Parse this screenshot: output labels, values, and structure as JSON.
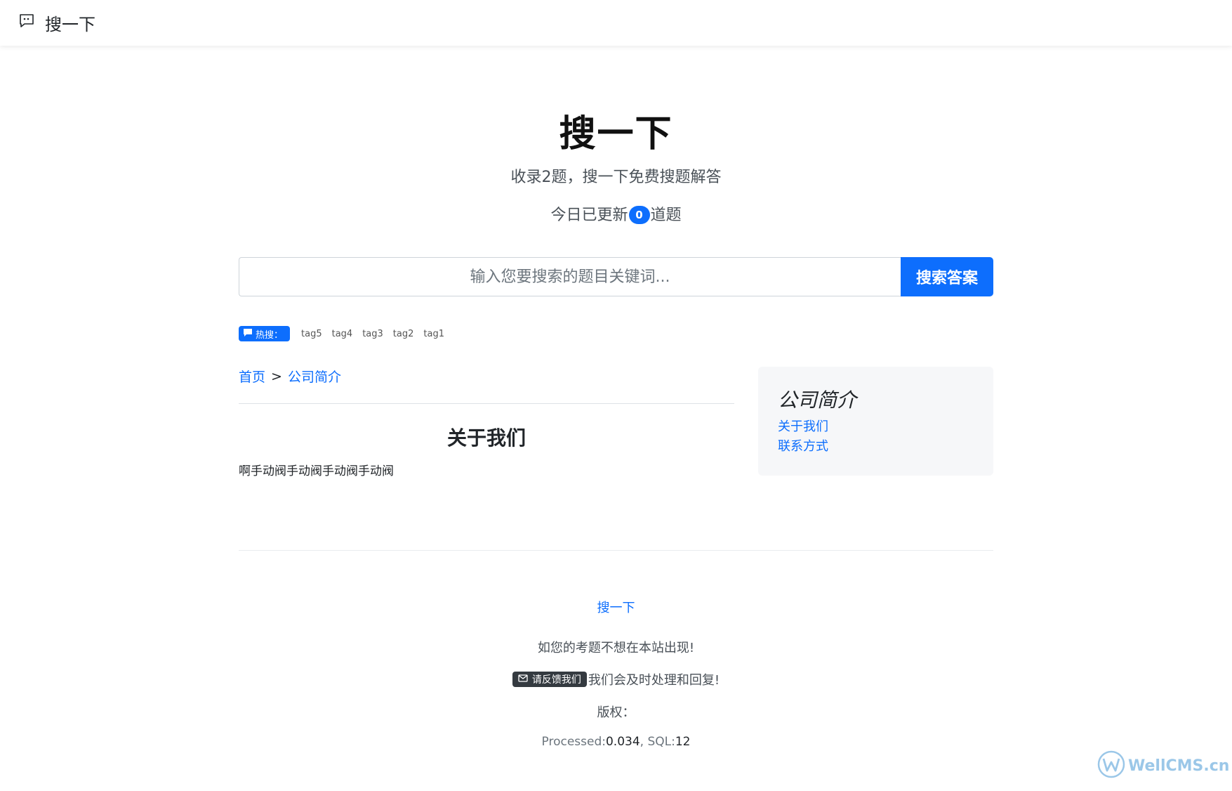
{
  "header": {
    "brand": "搜一下",
    "brand_icon": "quote-message-icon"
  },
  "hero": {
    "title": "搜一下",
    "subtitle": "收录2题，搜一下免费搜题解答",
    "today_prefix": "今日已更新",
    "today_count": "0",
    "today_suffix": "道题"
  },
  "search": {
    "placeholder": "输入您要搜索的题目关键词...",
    "value": "",
    "button_label": "搜索答案"
  },
  "hot": {
    "label": "热搜：",
    "tags": [
      "tag5",
      "tag4",
      "tag3",
      "tag2",
      "tag1"
    ]
  },
  "breadcrumb": {
    "home": "首页",
    "separator": ">",
    "current": "公司简介"
  },
  "article": {
    "title": "关于我们",
    "body": "啊手动阀手动阀手动阀手动阀"
  },
  "sidebar": {
    "title": "公司简介",
    "links": [
      "关于我们",
      "联系方式"
    ]
  },
  "footer": {
    "brand_link": "搜一下",
    "notice": "如您的考题不想在本站出现!",
    "feedback_button": "请反馈我们",
    "feedback_suffix": "我们会及时处理和回复!",
    "copyright": "版权：",
    "processed_label": "Processed:",
    "processed_value": "0.034",
    "sql_label": ", SQL:",
    "sql_value": "12"
  },
  "watermark": "WellCMS.cn",
  "colors": {
    "primary": "#0d6efd",
    "dark": "#343a40",
    "muted": "#6c757d"
  }
}
